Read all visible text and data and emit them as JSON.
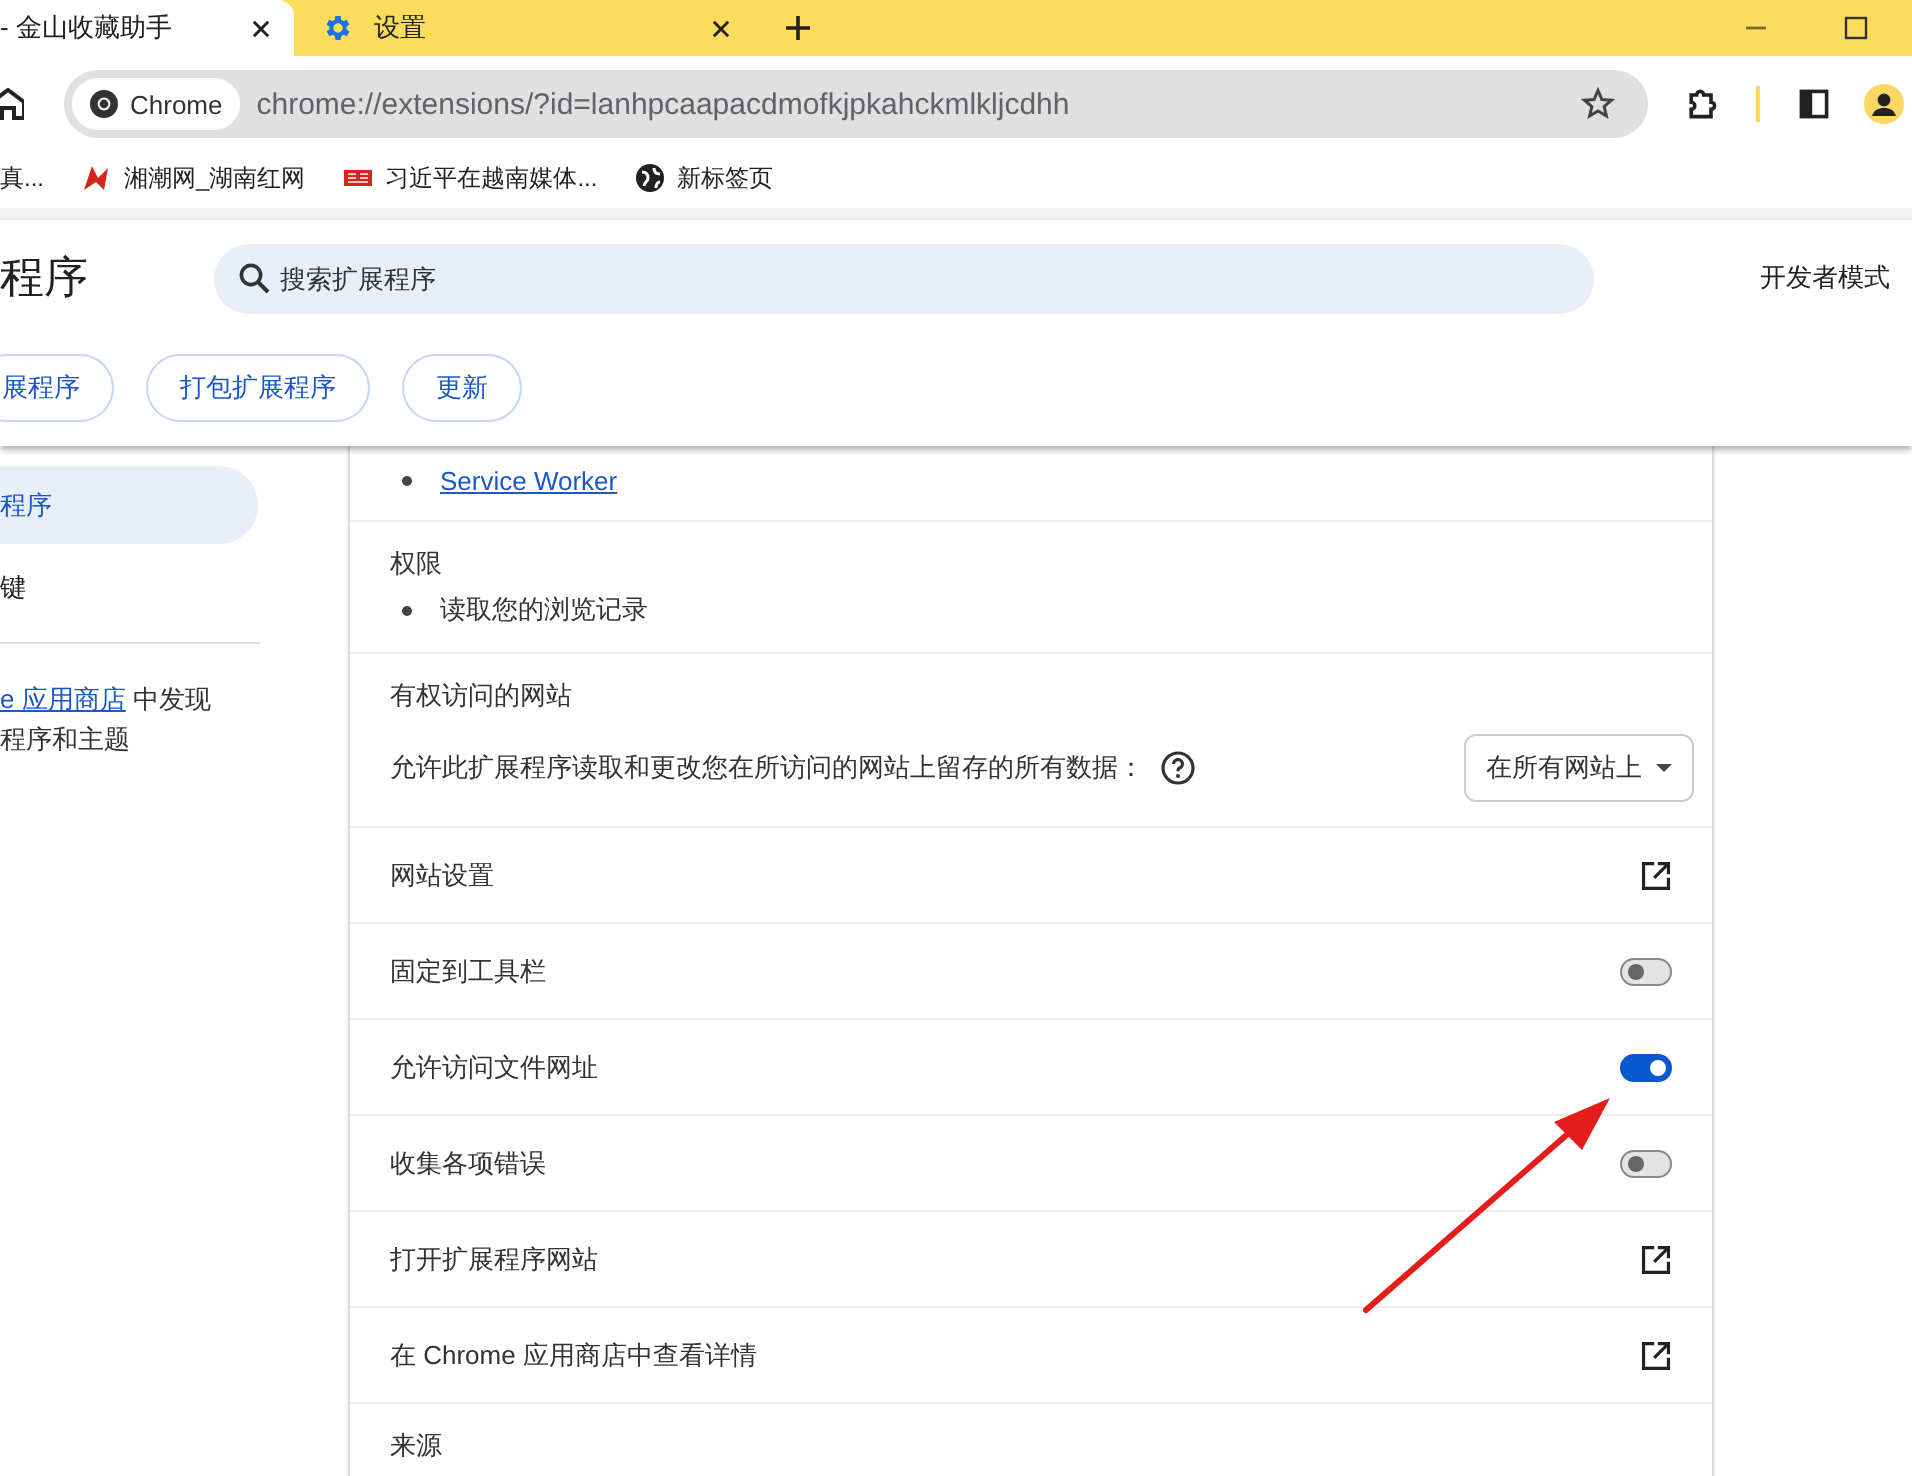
{
  "tabs": [
    {
      "title": "- 金山收藏助手",
      "selected": true,
      "kind": "page"
    },
    {
      "title": "设置",
      "selected": false,
      "kind": "settings"
    }
  ],
  "address_bar": {
    "chip": "Chrome",
    "url": "chrome://extensions/?id=lanhpcaapacdmofkjpkahckmlkljcdhh"
  },
  "bookmarks": [
    {
      "label": "真...",
      "kind": "plain"
    },
    {
      "label": "湘潮网_湖南红网",
      "kind": "logo"
    },
    {
      "label": "习近平在越南媒体...",
      "kind": "badge"
    },
    {
      "label": "新标签页",
      "kind": "globe"
    }
  ],
  "header": {
    "title": "程序",
    "search_placeholder": "搜索扩展程序",
    "developer_mode": "开发者模式",
    "actions": [
      "展程序",
      "打包扩展程序",
      "更新"
    ]
  },
  "sidebar": {
    "items": [
      {
        "label": "程序",
        "selected": true
      },
      {
        "label": "键",
        "selected": false
      }
    ],
    "store_note": {
      "link": "e 应用商店",
      "line1": " 中发现",
      "line2": "程序和主题"
    }
  },
  "details": {
    "views": [
      "Service Worker"
    ],
    "permissions": {
      "title": "权限",
      "items": [
        "读取您的浏览记录"
      ]
    },
    "site_access": {
      "title": "有权访问的网站",
      "description": "允许此扩展程序读取和更改您在所访问的网站上留存的所有数据：",
      "select": "在所有网站上"
    },
    "rows": [
      {
        "label": "网站设置",
        "kind": "link"
      },
      {
        "label": "固定到工具栏",
        "kind": "toggle",
        "on": false
      },
      {
        "label": "允许访问文件网址",
        "kind": "toggle",
        "on": true
      },
      {
        "label": "收集各项错误",
        "kind": "toggle",
        "on": false
      },
      {
        "label": "打开扩展程序网站",
        "kind": "link"
      },
      {
        "label": "在 Chrome 应用商店中查看详情",
        "kind": "link"
      }
    ],
    "source_title": "来源"
  }
}
